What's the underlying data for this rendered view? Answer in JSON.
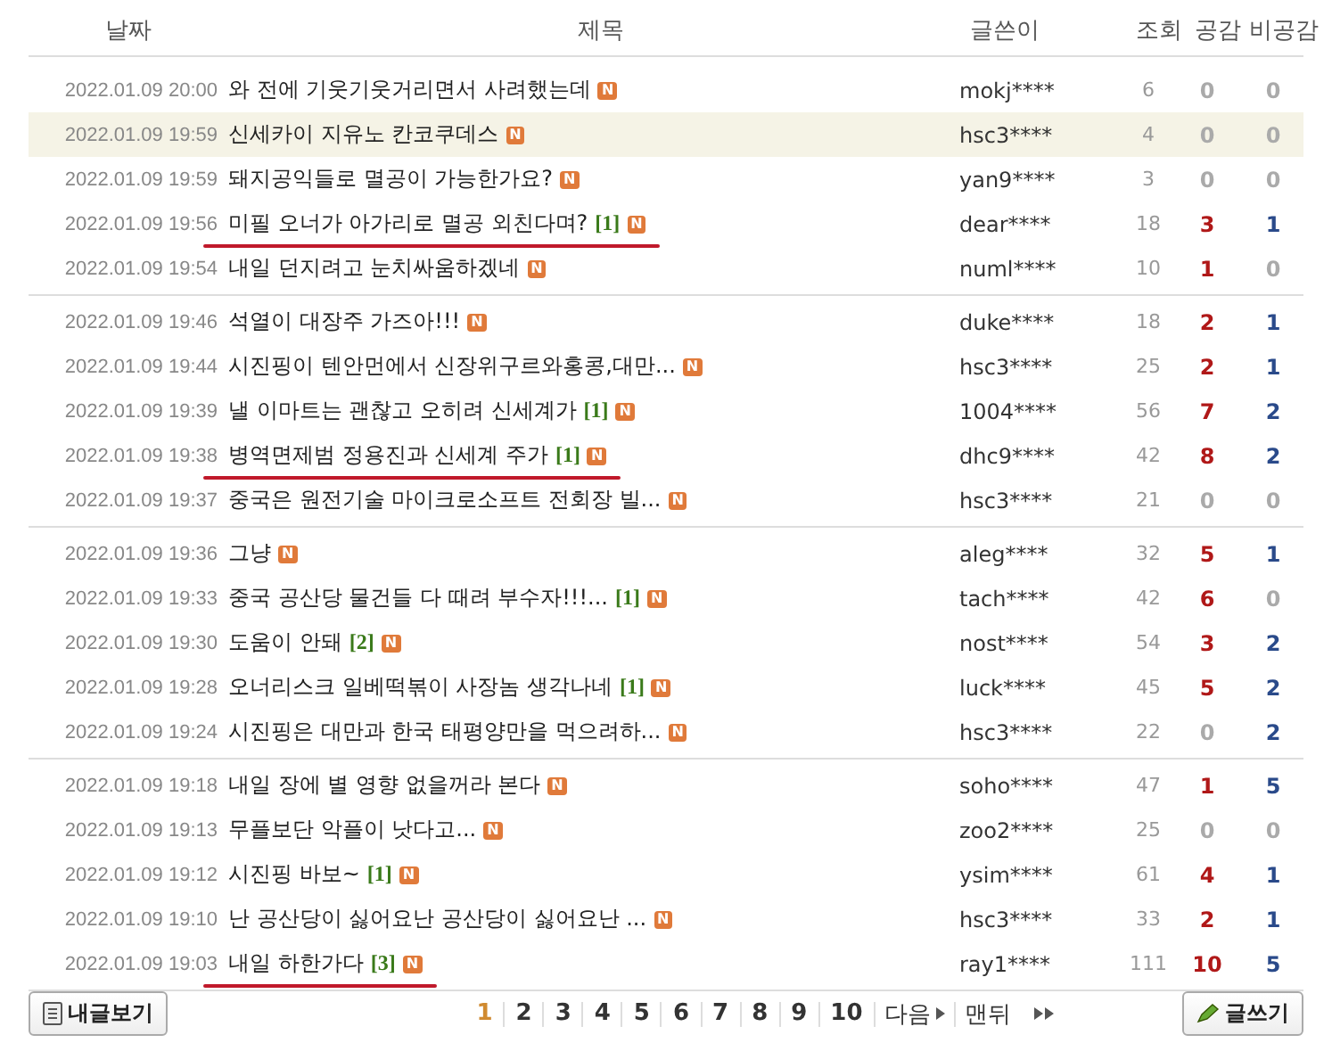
{
  "columns": [
    "날짜",
    "제목",
    "글쓴이",
    "조회",
    "공감",
    "비공감"
  ],
  "groups": [
    {
      "rows": [
        {
          "date": "2022.01.09 20:00",
          "title": "와 전에 기웃기웃거리면서 사려했는데",
          "badge": "N",
          "author": "mokj****",
          "views": "6",
          "likes": "0",
          "likes_active": false,
          "dislikes": "0",
          "dislikes_active": false,
          "selected": false,
          "underlined": false
        },
        {
          "date": "2022.01.09 19:59",
          "title": "신세카이 지유노 칸코쿠데스",
          "badge": "N",
          "author": "hsc3****",
          "views": "4",
          "likes": "0",
          "likes_active": false,
          "dislikes": "0",
          "dislikes_active": false,
          "selected": true,
          "underlined": false
        },
        {
          "date": "2022.01.09 19:59",
          "title": "돼지공익들로 멸공이 가능한가요?",
          "badge": "N",
          "author": "yan9****",
          "views": "3",
          "likes": "0",
          "likes_active": false,
          "dislikes": "0",
          "dislikes_active": false,
          "selected": false,
          "underlined": false
        },
        {
          "date": "2022.01.09 19:56",
          "title": "미필 오너가 아가리로 멸공 외친다며?",
          "comments": "[1]",
          "badge": "N",
          "author": "dear****",
          "views": "18",
          "likes": "3",
          "likes_active": true,
          "dislikes": "1",
          "dislikes_active": true,
          "selected": false,
          "underlined": true
        },
        {
          "date": "2022.01.09 19:54",
          "title": "내일 던지려고 눈치싸움하겠네",
          "badge": "N",
          "author": "numl****",
          "views": "10",
          "likes": "1",
          "likes_active": true,
          "dislikes": "0",
          "dislikes_active": false,
          "selected": false,
          "underlined": false
        }
      ]
    },
    {
      "rows": [
        {
          "date": "2022.01.09 19:46",
          "title": "석열이 대장주 가즈아!!!",
          "badge": "N",
          "author": "duke****",
          "views": "18",
          "likes": "2",
          "likes_active": true,
          "dislikes": "1",
          "dislikes_active": true,
          "selected": false,
          "underlined": false
        },
        {
          "date": "2022.01.09 19:44",
          "title": "시진핑이 텐안먼에서 신장위구르와홍콩,대만...",
          "badge": "N",
          "author": "hsc3****",
          "views": "25",
          "likes": "2",
          "likes_active": true,
          "dislikes": "1",
          "dislikes_active": true,
          "selected": false,
          "underlined": false
        },
        {
          "date": "2022.01.09 19:39",
          "title": "낼 이마트는 괜찮고 오히려 신세계가",
          "comments": "[1]",
          "badge": "N",
          "author": "1004****",
          "views": "56",
          "likes": "7",
          "likes_active": true,
          "dislikes": "2",
          "dislikes_active": true,
          "selected": false,
          "underlined": false
        },
        {
          "date": "2022.01.09 19:38",
          "title": "병역면제범 정용진과 신세계 주가",
          "comments": "[1]",
          "badge": "N",
          "author": "dhc9****",
          "views": "42",
          "likes": "8",
          "likes_active": true,
          "dislikes": "2",
          "dislikes_active": true,
          "selected": false,
          "underlined": true
        },
        {
          "date": "2022.01.09 19:37",
          "title": "중국은 원전기술 마이크로소프트 전회장 빌...",
          "badge": "N",
          "author": "hsc3****",
          "views": "21",
          "likes": "0",
          "likes_active": false,
          "dislikes": "0",
          "dislikes_active": false,
          "selected": false,
          "underlined": false
        }
      ]
    },
    {
      "rows": [
        {
          "date": "2022.01.09 19:36",
          "title": "그냥",
          "badge": "N",
          "author": "aleg****",
          "views": "32",
          "likes": "5",
          "likes_active": true,
          "dislikes": "1",
          "dislikes_active": true,
          "selected": false,
          "underlined": false
        },
        {
          "date": "2022.01.09 19:33",
          "title": "중국 공산당 물건들 다 때려 부수자!!!...",
          "comments": "[1]",
          "badge": "N",
          "author": "tach****",
          "views": "42",
          "likes": "6",
          "likes_active": true,
          "dislikes": "0",
          "dislikes_active": false,
          "selected": false,
          "underlined": false
        },
        {
          "date": "2022.01.09 19:30",
          "title": "도움이 안돼",
          "comments": "[2]",
          "badge": "N",
          "author": "nost****",
          "views": "54",
          "likes": "3",
          "likes_active": true,
          "dislikes": "2",
          "dislikes_active": true,
          "selected": false,
          "underlined": false
        },
        {
          "date": "2022.01.09 19:28",
          "title": "오너리스크 일베떡볶이 사장놈 생각나네",
          "comments": "[1]",
          "badge": "N",
          "author": "luck****",
          "views": "45",
          "likes": "5",
          "likes_active": true,
          "dislikes": "2",
          "dislikes_active": true,
          "selected": false,
          "underlined": false
        },
        {
          "date": "2022.01.09 19:24",
          "title": "시진핑은 대만과 한국 태평양만을 먹으려하...",
          "badge": "N",
          "author": "hsc3****",
          "views": "22",
          "likes": "0",
          "likes_active": false,
          "dislikes": "2",
          "dislikes_active": true,
          "selected": false,
          "underlined": false
        }
      ]
    },
    {
      "rows": [
        {
          "date": "2022.01.09 19:18",
          "title": "내일 장에 별 영향 없을꺼라 본다",
          "badge": "N",
          "author": "soho****",
          "views": "47",
          "likes": "1",
          "likes_active": true,
          "dislikes": "5",
          "dislikes_active": true,
          "selected": false,
          "underlined": false
        },
        {
          "date": "2022.01.09 19:13",
          "title": "무플보단 악플이 낫다고...",
          "badge": "N",
          "author": "zoo2****",
          "views": "25",
          "likes": "0",
          "likes_active": false,
          "dislikes": "0",
          "dislikes_active": false,
          "selected": false,
          "underlined": false
        },
        {
          "date": "2022.01.09 19:12",
          "title": "시진핑 바보~",
          "comments": "[1]",
          "badge": "N",
          "author": "ysim****",
          "views": "61",
          "likes": "4",
          "likes_active": true,
          "dislikes": "1",
          "dislikes_active": true,
          "selected": false,
          "underlined": false
        },
        {
          "date": "2022.01.09 19:10",
          "title": "난 공산당이 싫어요난 공산당이 싫어요난 ...",
          "badge": "N",
          "author": "hsc3****",
          "views": "33",
          "likes": "2",
          "likes_active": true,
          "dislikes": "1",
          "dislikes_active": true,
          "selected": false,
          "underlined": false
        },
        {
          "date": "2022.01.09 19:03",
          "title": "내일 하한가다",
          "comments": "[3]",
          "badge": "N",
          "author": "ray1****",
          "views": "111",
          "likes": "10",
          "likes_active": true,
          "dislikes": "5",
          "dislikes_active": true,
          "selected": false,
          "underlined": true
        }
      ]
    }
  ],
  "my_posts_button": "내글보기",
  "pages": [
    {
      "label": "1",
      "selected": true
    },
    {
      "label": "2",
      "selected": false
    },
    {
      "label": "3",
      "selected": false
    },
    {
      "label": "4",
      "selected": false
    },
    {
      "label": "5",
      "selected": false
    },
    {
      "label": "6",
      "selected": false
    },
    {
      "label": "7",
      "selected": false
    },
    {
      "label": "8",
      "selected": false
    },
    {
      "label": "9",
      "selected": false
    },
    {
      "label": "10",
      "selected": false
    }
  ],
  "next": "다음",
  "last": "맨뒤",
  "write_button": "글쓰기"
}
